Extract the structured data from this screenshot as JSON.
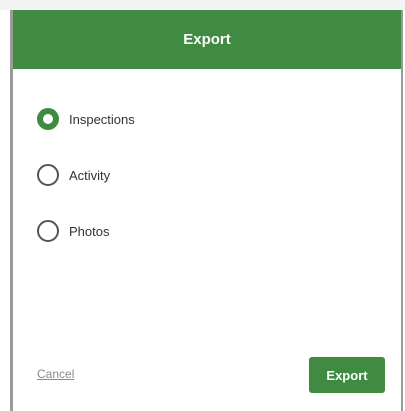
{
  "dialog": {
    "title": "Export",
    "options": [
      {
        "label": "Inspections",
        "selected": true
      },
      {
        "label": "Activity",
        "selected": false
      },
      {
        "label": "Photos",
        "selected": false
      }
    ],
    "cancel_label": "Cancel",
    "export_label": "Export"
  },
  "colors": {
    "accent": "#3e8b41",
    "header_text": "#ffffff",
    "cancel_text": "#8a8a8a"
  }
}
